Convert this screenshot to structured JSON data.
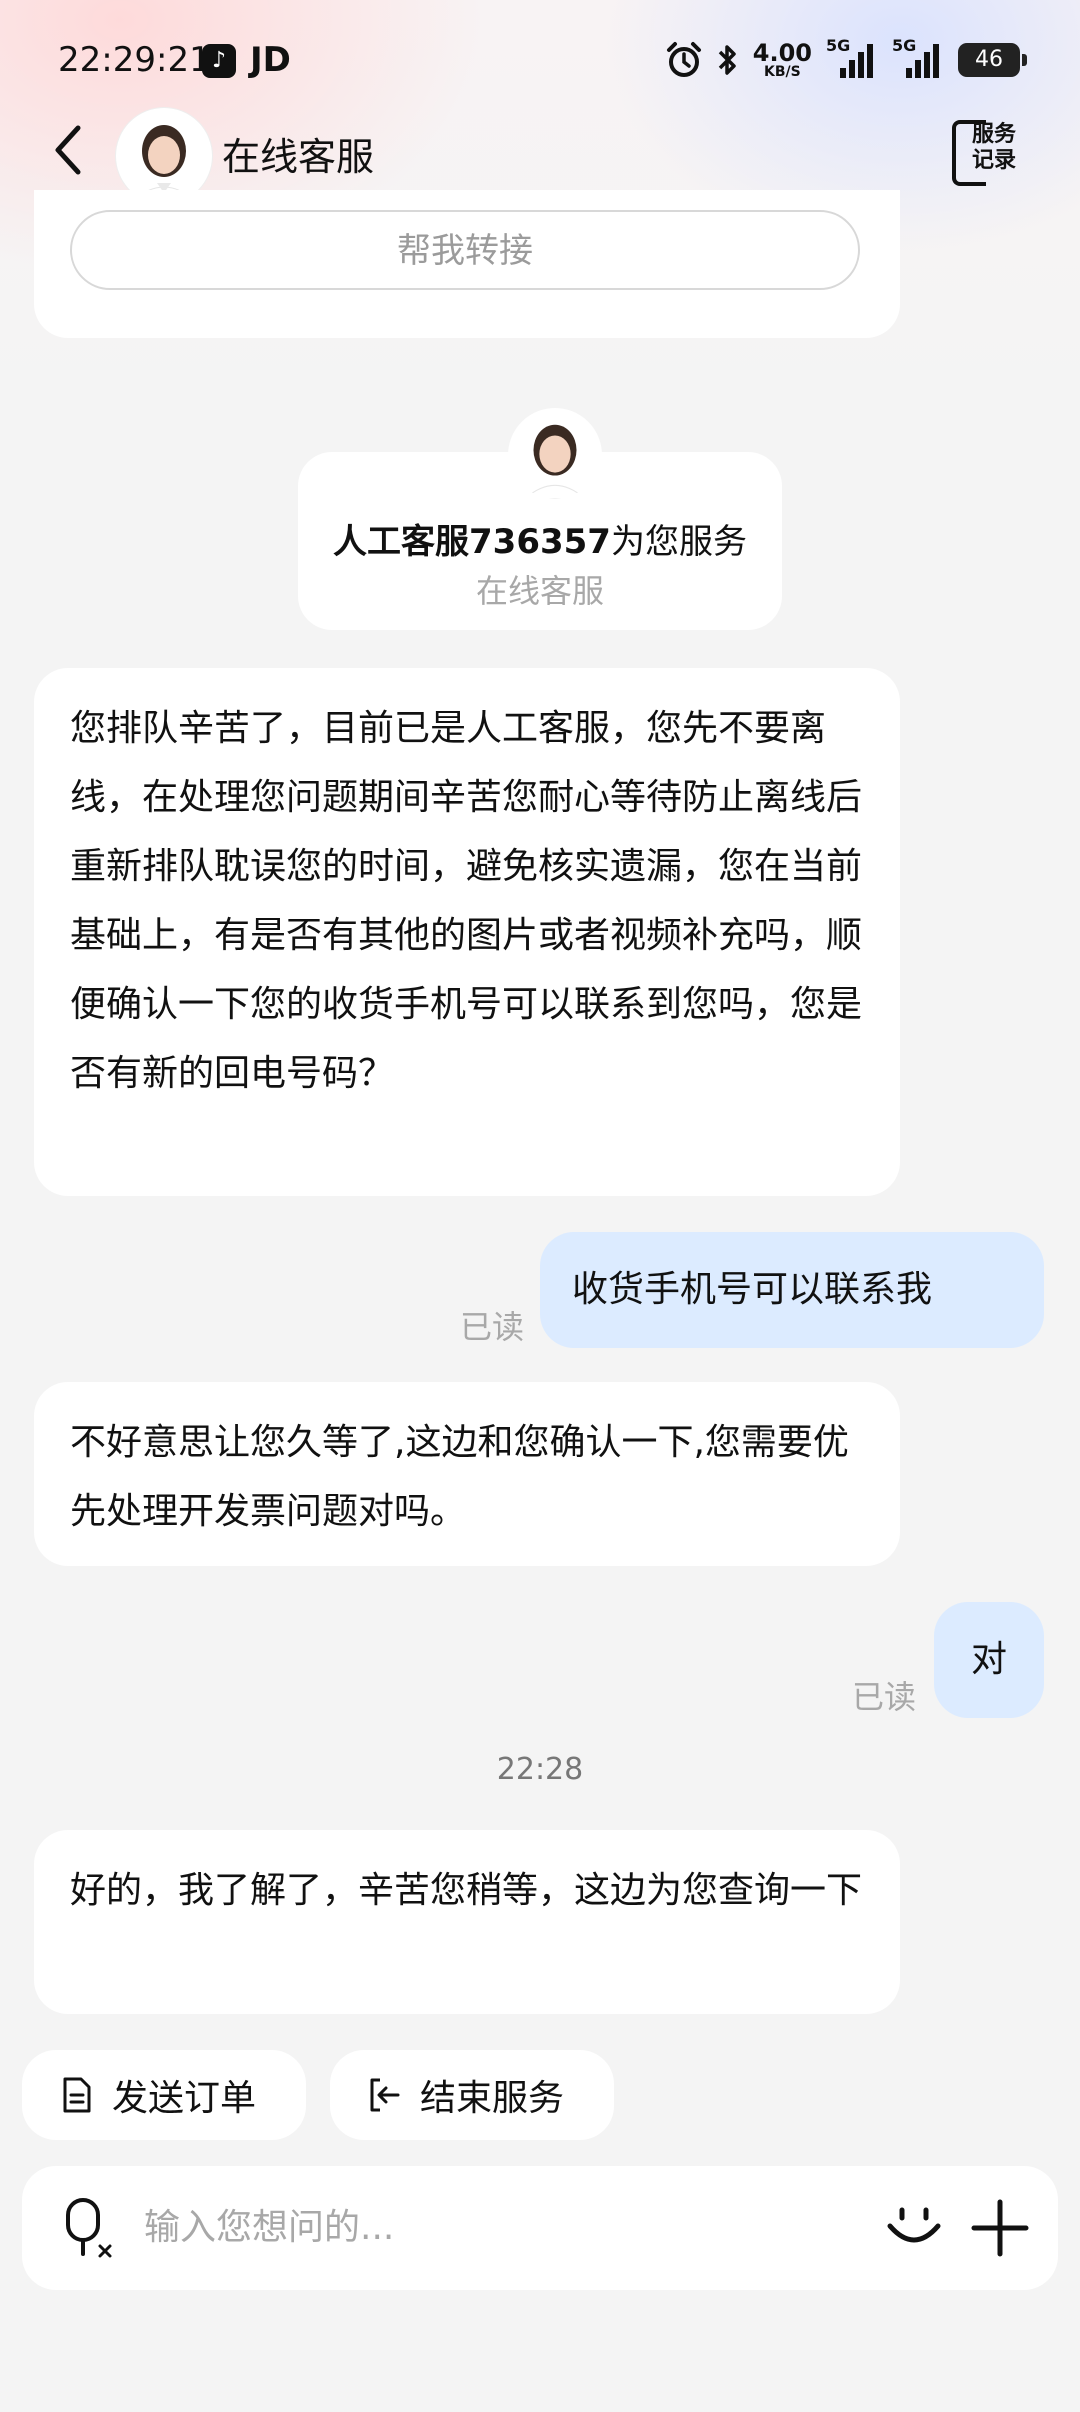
{
  "status_bar": {
    "time": "22:29:21",
    "app_jd": "JD",
    "net_speed_value": "4.00",
    "net_speed_unit": "KB/S",
    "signal1_label": "5G",
    "signal2_label": "5G",
    "battery": "46",
    "icons": [
      "tiktok-icon",
      "alarm-icon",
      "bluetooth-icon",
      "signal-icon",
      "battery-icon"
    ]
  },
  "header": {
    "title": "在线客服",
    "records_label_line1": "服务",
    "records_label_line2": "记录"
  },
  "top_card": {
    "transfer_button": "帮我转接"
  },
  "agent_card": {
    "agent_id": "人工客服736357",
    "service_suffix": "为您服务",
    "subtitle": "在线客服"
  },
  "messages": {
    "m1": "您排队辛苦了，目前已是人工客服，您先不要离线，在处理您问题期间辛苦您耐心等待防止离线后重新排队耽误您的时间，避免核实遗漏，您在当前基础上，有是否有其他的图片或者视频补充吗，顺便确认一下您的收货手机号可以联系到您吗，您是否有新的回电号码？",
    "m2": "收货手机号可以联系我",
    "m2_status": "已读",
    "m3": "不好意思让您久等了,这边和您确认一下,您需要优先处理开发票问题对吗。",
    "m4": "对",
    "m4_status": "已读",
    "timestamp": "22:28",
    "m5": "好的，我了解了，辛苦您稍等，这边为您查询一下"
  },
  "quick_actions": {
    "send_order": "发送订单",
    "end_service": "结束服务"
  },
  "input": {
    "placeholder": "输入您想问的..."
  },
  "colors": {
    "background": "#f4f4f4",
    "outgoing_bubble": "#dcebff",
    "incoming_bubble": "#ffffff",
    "muted_text": "#a8a8a8"
  }
}
